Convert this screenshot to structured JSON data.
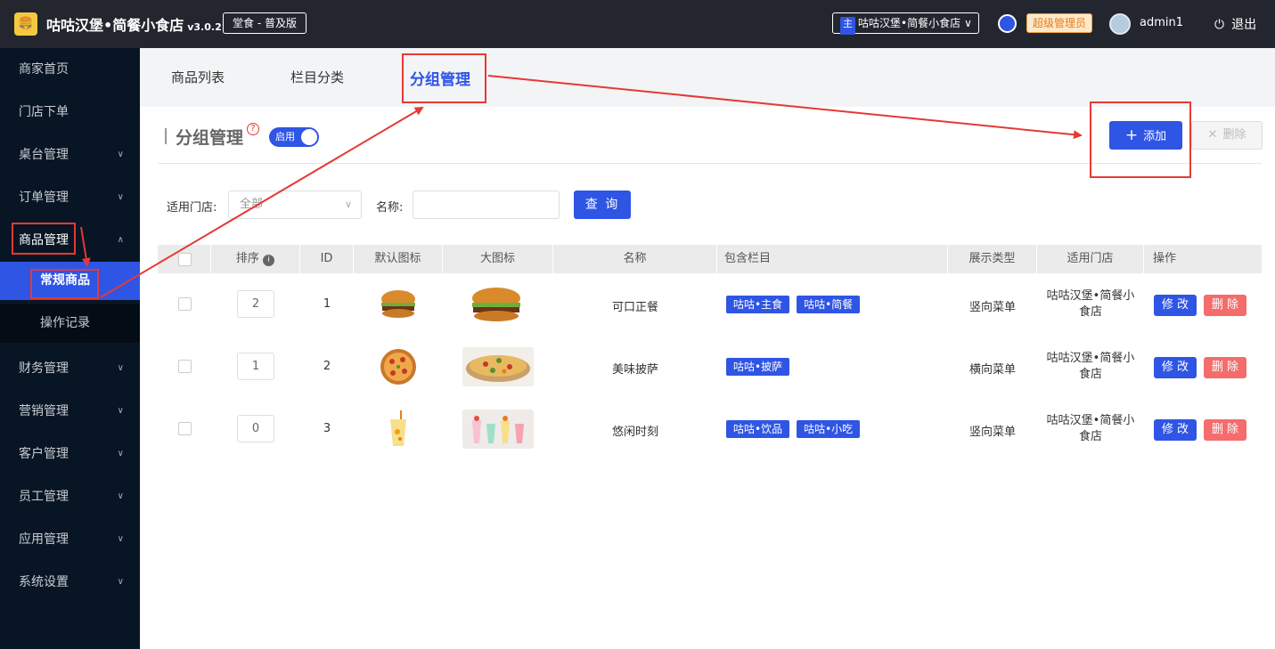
{
  "header": {
    "brand": "咕咕汉堡•简餐小食店",
    "version": "v3.0.2",
    "edition": "堂食 - 普及版",
    "store_tag": "主",
    "store_name": "咕咕汉堡•简餐小食店",
    "role": "超级管理员",
    "username": "admin1",
    "logout": "退出"
  },
  "sidebar": {
    "items": [
      {
        "label": "商家首页"
      },
      {
        "label": "门店下单"
      },
      {
        "label": "桌台管理"
      },
      {
        "label": "订单管理"
      },
      {
        "label": "商品管理"
      },
      {
        "label": "财务管理"
      },
      {
        "label": "营销管理"
      },
      {
        "label": "客户管理"
      },
      {
        "label": "员工管理"
      },
      {
        "label": "应用管理"
      },
      {
        "label": "系统设置"
      }
    ],
    "sub_items": [
      {
        "label": "常规商品"
      },
      {
        "label": "操作记录"
      }
    ]
  },
  "tabs": [
    {
      "label": "商品列表"
    },
    {
      "label": "栏目分类"
    },
    {
      "label": "分组管理"
    }
  ],
  "page": {
    "title": "分组管理",
    "help": "?",
    "switch_label": "启用",
    "add_button": "添加",
    "delete_button": "删除"
  },
  "filters": {
    "store_label": "适用门店:",
    "store_value": "全部",
    "name_label": "名称:",
    "name_value": "",
    "query_button": "查 询"
  },
  "table": {
    "columns": [
      "排序",
      "ID",
      "默认图标",
      "大图标",
      "名称",
      "包含栏目",
      "展示类型",
      "适用门店",
      "操作"
    ],
    "rows": [
      {
        "sort": "2",
        "id": "1",
        "name": "可口正餐",
        "tags": [
          "咕咕•主食",
          "咕咕•简餐"
        ],
        "display": "竖向菜单",
        "store": "咕咕汉堡•简餐小食店",
        "icon": "burger"
      },
      {
        "sort": "1",
        "id": "2",
        "name": "美味披萨",
        "tags": [
          "咕咕•披萨"
        ],
        "display": "横向菜单",
        "store": "咕咕汉堡•简餐小食店",
        "icon": "pizza"
      },
      {
        "sort": "0",
        "id": "3",
        "name": "悠闲时刻",
        "tags": [
          "咕咕•饮品",
          "咕咕•小吃"
        ],
        "display": "竖向菜单",
        "store": "咕咕汉堡•简餐小食店",
        "icon": "drinks"
      }
    ],
    "edit_label": "修 改",
    "delete_label": "删 除"
  }
}
